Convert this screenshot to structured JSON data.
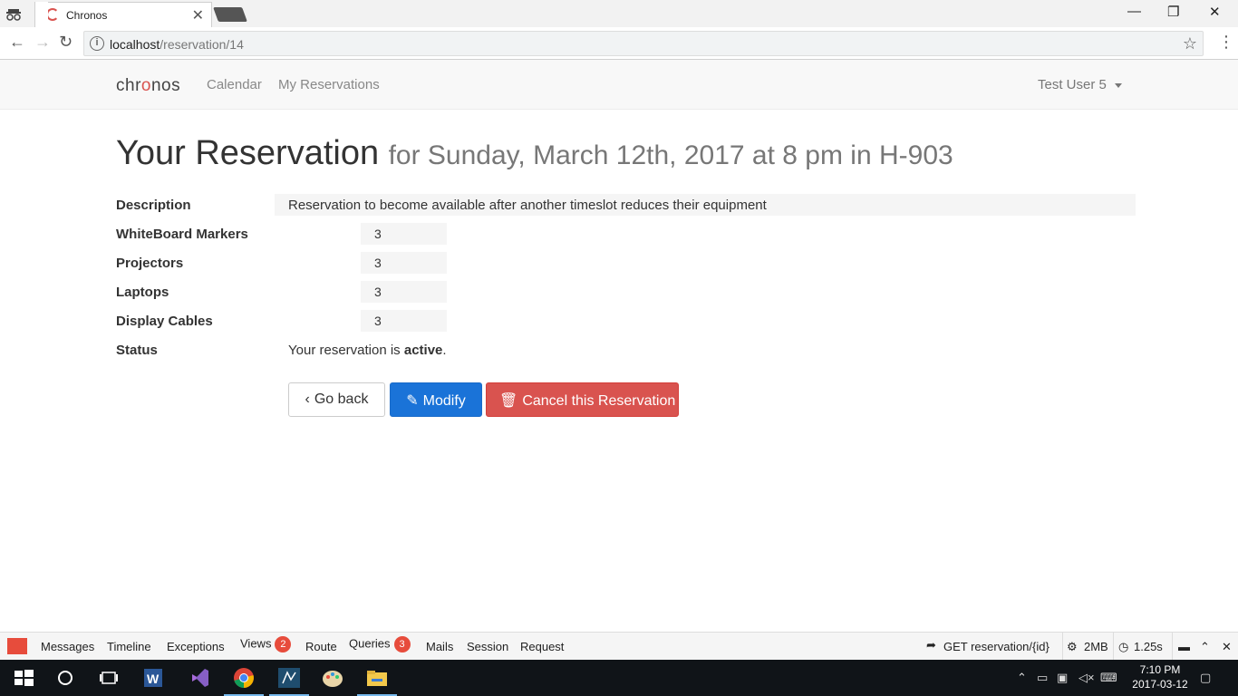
{
  "browser": {
    "tab_title": "Chronos",
    "tab_close": "✕",
    "url_host": "localhost",
    "url_path": "/reservation/14",
    "window_controls": {
      "minimize": "—",
      "maximize": "❐",
      "close": "✕"
    }
  },
  "navbar": {
    "brand": "chronos",
    "links": [
      "Calendar",
      "My Reservations"
    ],
    "user": "Test User 5"
  },
  "page": {
    "title": "Your Reservation",
    "subtitle": "for Sunday, March 12th, 2017 at 8 pm in H-903"
  },
  "details": {
    "description_label": "Description",
    "description_value": "Reservation to become available after another timeslot reduces their equipment",
    "equipment": [
      {
        "label": "WhiteBoard Markers",
        "value": "3"
      },
      {
        "label": "Projectors",
        "value": "3"
      },
      {
        "label": "Laptops",
        "value": "3"
      },
      {
        "label": "Display Cables",
        "value": "3"
      }
    ],
    "status_label": "Status",
    "status_prefix": "Your reservation is ",
    "status_value": "active",
    "status_suffix": "."
  },
  "actions": {
    "back": "Go back",
    "modify": "Modify",
    "cancel": "Cancel this Reservation"
  },
  "debugbar": {
    "items": [
      "Messages",
      "Timeline",
      "Exceptions",
      "Views",
      "Route",
      "Queries",
      "Mails",
      "Session",
      "Request"
    ],
    "views_count": "2",
    "queries_count": "3",
    "route": "GET reservation/{id}",
    "memory": "2MB",
    "time": "1.25s"
  },
  "taskbar": {
    "time": "7:10 PM",
    "date": "2017-03-12"
  }
}
